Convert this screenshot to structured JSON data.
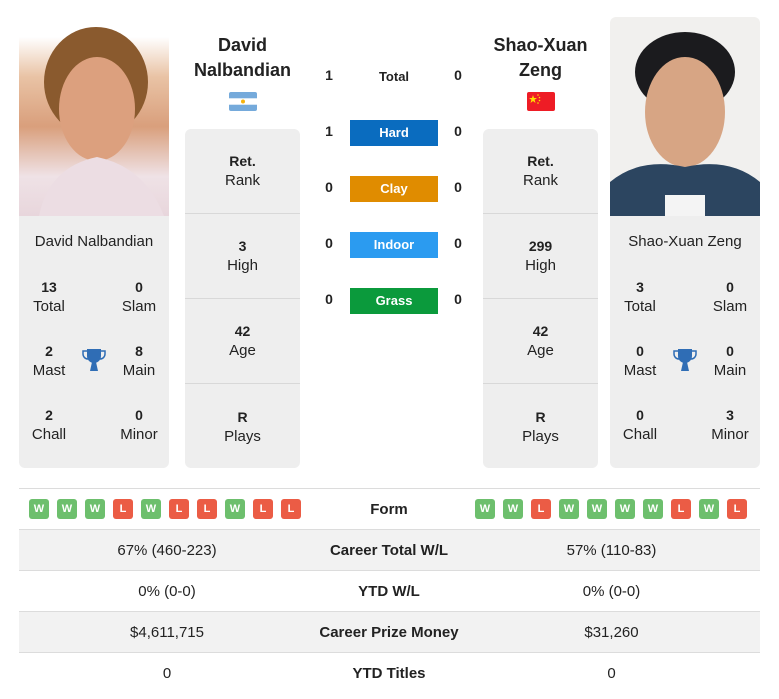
{
  "players": {
    "left": {
      "name_line1": "David",
      "name_line2": "Nalbandian",
      "full_name": "David Nalbandian",
      "country": "Argentina",
      "flag_icon": "argentina-flag-icon",
      "rank": {
        "value": "Ret.",
        "label": "Rank"
      },
      "high": {
        "value": "3",
        "label": "High"
      },
      "age": {
        "value": "42",
        "label": "Age"
      },
      "plays": {
        "value": "R",
        "label": "Plays"
      },
      "titles": {
        "total": {
          "value": "13",
          "label": "Total"
        },
        "slam": {
          "value": "0",
          "label": "Slam"
        },
        "mast": {
          "value": "2",
          "label": "Mast"
        },
        "main": {
          "value": "8",
          "label": "Main"
        },
        "chall": {
          "value": "2",
          "label": "Chall"
        },
        "minor": {
          "value": "0",
          "label": "Minor"
        }
      },
      "form": [
        "W",
        "W",
        "W",
        "L",
        "W",
        "L",
        "L",
        "W",
        "L",
        "L"
      ],
      "career_wl": "67% (460-223)",
      "ytd_wl": "0% (0-0)",
      "prize_money": "$4,611,715",
      "ytd_titles": "0"
    },
    "right": {
      "name_line1": "Shao-Xuan",
      "name_line2": "Zeng",
      "full_name": "Shao-Xuan Zeng",
      "country": "China",
      "flag_icon": "china-flag-icon",
      "rank": {
        "value": "Ret.",
        "label": "Rank"
      },
      "high": {
        "value": "299",
        "label": "High"
      },
      "age": {
        "value": "42",
        "label": "Age"
      },
      "plays": {
        "value": "R",
        "label": "Plays"
      },
      "titles": {
        "total": {
          "value": "3",
          "label": "Total"
        },
        "slam": {
          "value": "0",
          "label": "Slam"
        },
        "mast": {
          "value": "0",
          "label": "Mast"
        },
        "main": {
          "value": "0",
          "label": "Main"
        },
        "chall": {
          "value": "0",
          "label": "Chall"
        },
        "minor": {
          "value": "3",
          "label": "Minor"
        }
      },
      "form": [
        "W",
        "W",
        "L",
        "W",
        "W",
        "W",
        "W",
        "L",
        "W",
        "L"
      ],
      "career_wl": "57% (110-83)",
      "ytd_wl": "0% (0-0)",
      "prize_money": "$31,260",
      "ytd_titles": "0"
    }
  },
  "h2h": [
    {
      "label": "Total",
      "left": "1",
      "right": "0",
      "color": null
    },
    {
      "label": "Hard",
      "left": "1",
      "right": "0",
      "color": "#0a6cbf"
    },
    {
      "label": "Clay",
      "left": "0",
      "right": "0",
      "color": "#e08c00"
    },
    {
      "label": "Indoor",
      "left": "0",
      "right": "0",
      "color": "#2b9bf0"
    },
    {
      "label": "Grass",
      "left": "0",
      "right": "0",
      "color": "#0b9a3c"
    }
  ],
  "comparison_labels": {
    "form": "Form",
    "career_wl": "Career Total W/L",
    "ytd_wl": "YTD W/L",
    "prize_money": "Career Prize Money",
    "ytd_titles": "YTD Titles"
  },
  "colors": {
    "win": "#6dbf6d",
    "loss": "#eb5c45",
    "trophy": "#2f6db5"
  }
}
